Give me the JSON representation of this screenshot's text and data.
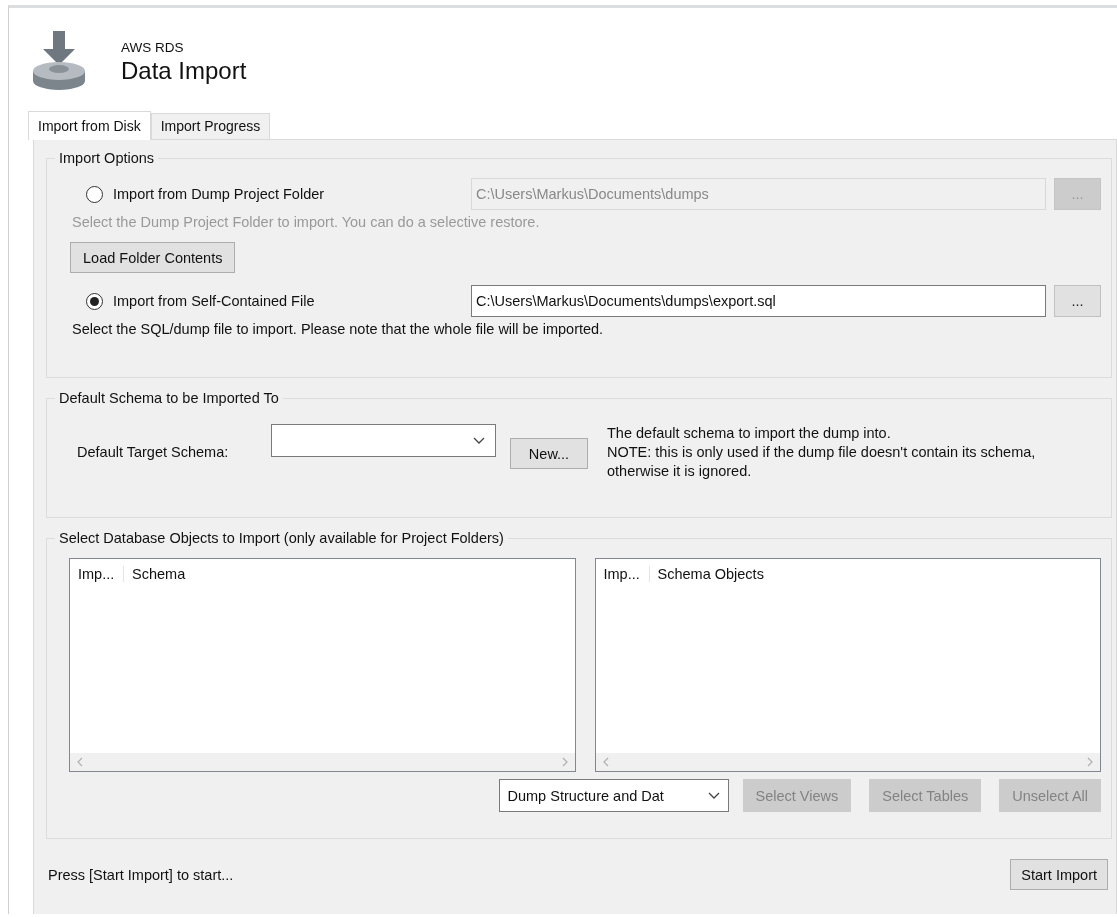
{
  "header": {
    "subtitle": "AWS RDS",
    "title": "Data Import"
  },
  "tabs": [
    {
      "label": "Import from Disk",
      "selected": true
    },
    {
      "label": "Import Progress",
      "selected": false
    }
  ],
  "import_options": {
    "legend": "Import Options",
    "options": [
      {
        "label": "Import from Dump Project Folder",
        "selected": false,
        "path": "C:\\Users\\Markus\\Documents\\dumps",
        "browse": "...",
        "disabled": true,
        "hint": "Select the Dump Project Folder to import. You can do a selective restore.",
        "action": "Load Folder Contents"
      },
      {
        "label": "Import from Self-Contained File",
        "selected": true,
        "path": "C:\\Users\\Markus\\Documents\\dumps\\export.sql",
        "browse": "...",
        "disabled": false,
        "hint": "Select the SQL/dump file to import. Please note that the whole file will be imported."
      }
    ]
  },
  "default_schema": {
    "legend": "Default Schema to be Imported To",
    "label": "Default Target Schema:",
    "new_button": "New...",
    "note": [
      "The default schema to import the dump into.",
      "NOTE: this is only used if the dump file doesn't contain its schema,",
      "otherwise it is ignored."
    ]
  },
  "objects": {
    "legend": "Select Database Objects to Import (only available for Project Folders)",
    "lists": [
      {
        "columns": [
          "Imp...",
          "Schema"
        ]
      },
      {
        "columns": [
          "Imp...",
          "Schema Objects"
        ]
      }
    ],
    "dump_select": "Dump Structure and Dat",
    "buttons": [
      {
        "label": "Select Views",
        "disabled": true
      },
      {
        "label": "Select Tables",
        "disabled": true
      },
      {
        "label": "Unselect All",
        "disabled": true
      }
    ]
  },
  "footer": {
    "status": "Press [Start Import] to start...",
    "start_button": "Start Import"
  }
}
